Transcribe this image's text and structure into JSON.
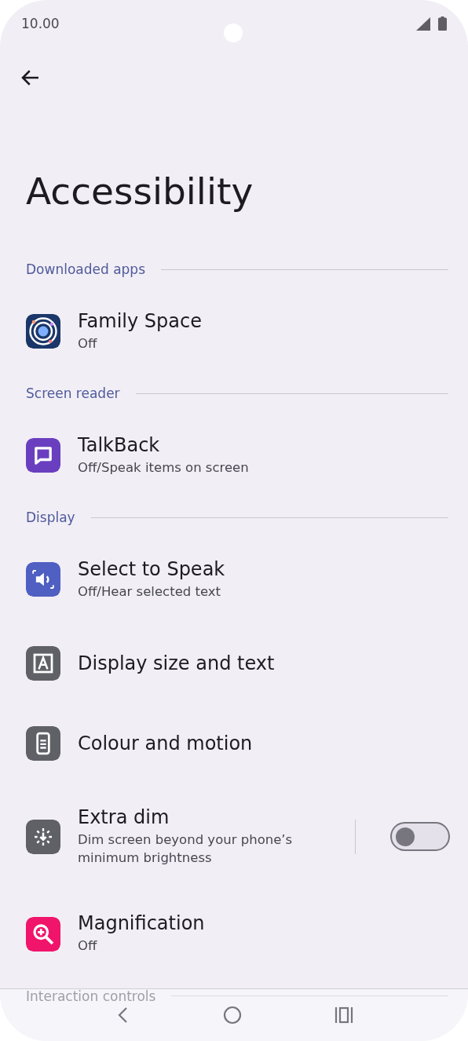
{
  "status_bar": {
    "time": "10.00"
  },
  "title": "Accessibility",
  "sections": [
    {
      "header": "Downloaded apps",
      "items": [
        {
          "title": "Family Space",
          "subtitle": "Off",
          "color": "#1b3668"
        }
      ]
    },
    {
      "header": "Screen reader",
      "items": [
        {
          "title": "TalkBack",
          "subtitle": "Off/Speak items on screen",
          "color": "#6a3fbf"
        }
      ]
    },
    {
      "header": "Display",
      "items": [
        {
          "title": "Select to Speak",
          "subtitle": "Off/Hear selected text",
          "color": "#4f5fc2"
        },
        {
          "title": "Display size and text",
          "color": "#5f6167"
        },
        {
          "title": "Colour and motion",
          "color": "#5f6167"
        },
        {
          "title": "Extra dim",
          "subtitle": "Dim screen beyond your phone’s minimum brightness",
          "color": "#5f6167",
          "toggle": {
            "on": false
          }
        },
        {
          "title": "Magnification",
          "subtitle": "Off",
          "color": "#f0146a"
        }
      ]
    },
    {
      "header": "Interaction controls"
    }
  ]
}
